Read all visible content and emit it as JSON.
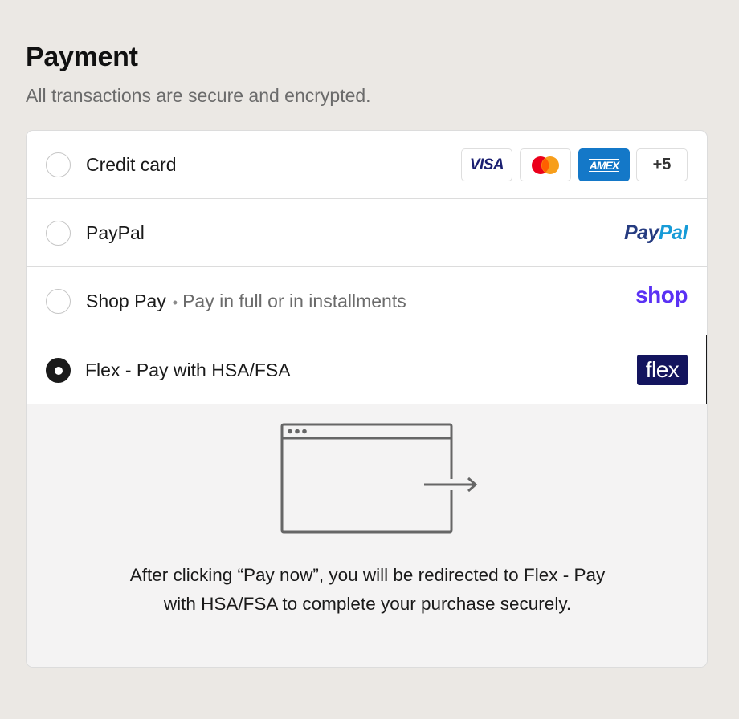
{
  "header": {
    "title": "Payment",
    "subtitle": "All transactions are secure and encrypted."
  },
  "options": [
    {
      "label": "Credit card",
      "selected": false,
      "badges": [
        "VISA",
        "AMEX",
        "+5"
      ],
      "badge_icons": [
        "visa-icon",
        "mastercard-icon",
        "amex-icon"
      ]
    },
    {
      "label": "PayPal",
      "selected": false,
      "logo_pay": "Pay",
      "logo_pal": "Pal"
    },
    {
      "label": "Shop Pay",
      "separator": "•",
      "sublabel": "Pay in full or in installments",
      "selected": false,
      "logo": "shop"
    },
    {
      "label": "Flex - Pay with HSA/FSA",
      "selected": true,
      "logo": "flex"
    }
  ],
  "details": {
    "illustration": "browser-redirect-icon",
    "message": "After clicking “Pay now”, you will be redirected to Flex - Pay with HSA/FSA to complete your purchase securely."
  },
  "colors": {
    "background": "#ebe8e4",
    "selected_border": "#1a1a1a",
    "paypal_dark": "#253b80",
    "paypal_light": "#179bd7",
    "shop_purple": "#5a31f4",
    "flex_navy": "#13145e",
    "amex_blue": "#1478c8"
  }
}
